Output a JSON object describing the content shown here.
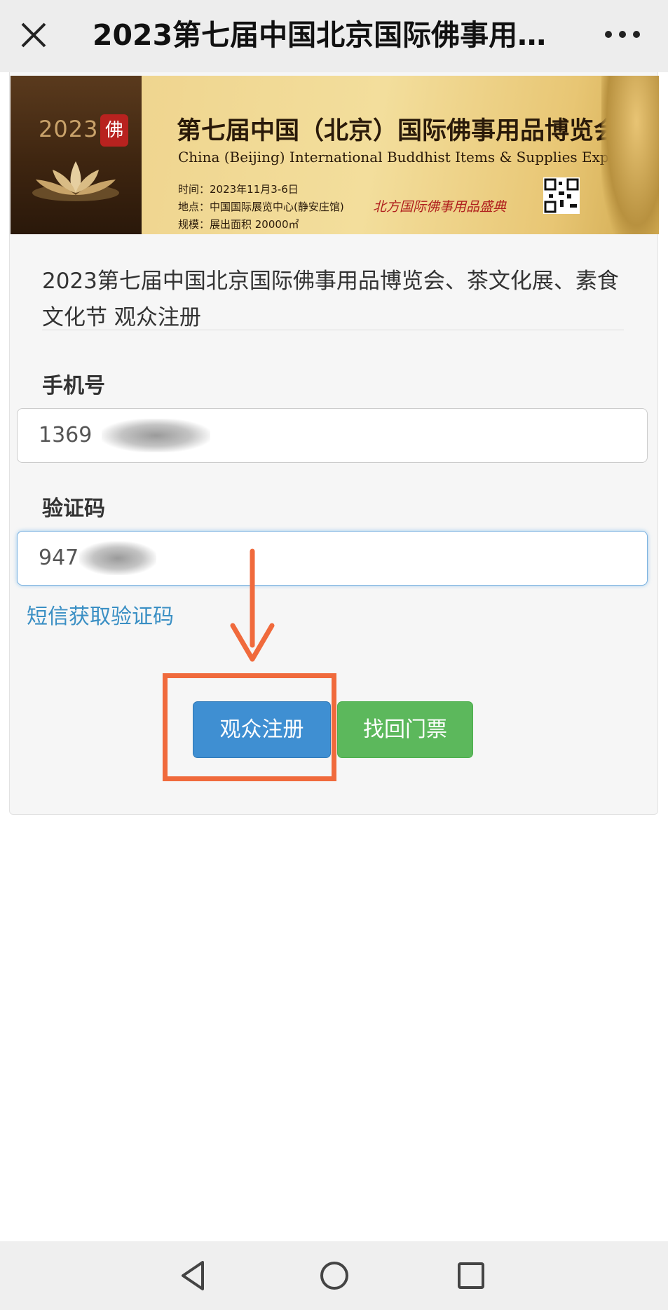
{
  "window": {
    "title": "2023第七届中国北京国际佛事用品...",
    "close_icon": "close-icon",
    "more_icon": "more-icon"
  },
  "banner": {
    "year": "2023",
    "seal_char": "佛",
    "title": "第七届中国（北京）国际佛事用品博览会",
    "subtitle": "China (Beijing) International Buddhist Items & Supplies Expo",
    "info": [
      "时间：2023年11月3-6日",
      "地点：中国国际展览中心(静安庄馆)",
      "规模：展出面积 20000㎡"
    ],
    "brand": "北方国际佛事用品盛典"
  },
  "form": {
    "header": "2023第七届中国北京国际佛事用品博览会、茶文化展、素食文化节 观众注册",
    "phone_label": "手机号",
    "phone_value": "1369",
    "code_label": "验证码",
    "code_value": "947",
    "sms_link": "短信获取验证码",
    "register_button": "观众注册",
    "retrieve_button": "找回门票"
  },
  "annotation": {
    "color": "#f06a3c"
  },
  "navbar": {
    "back_icon": "back-icon",
    "home_icon": "home-icon",
    "recents_icon": "recents-icon"
  }
}
